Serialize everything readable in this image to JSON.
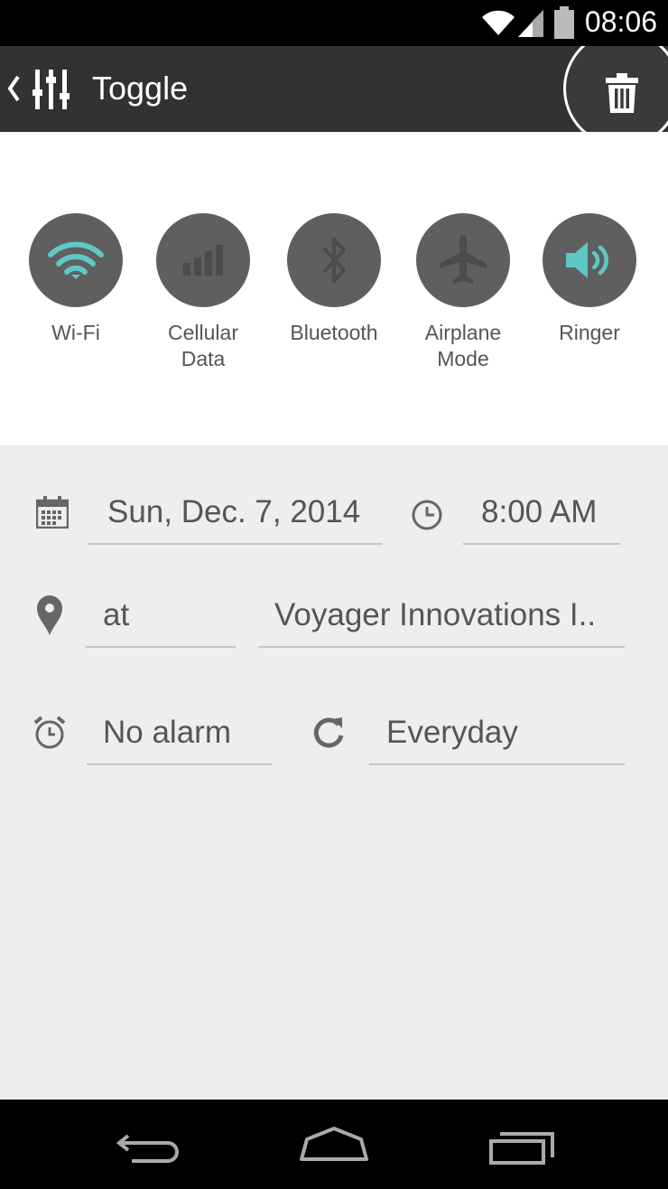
{
  "status_bar": {
    "time": "08:06",
    "icons": [
      "wifi-icon",
      "signal-icon",
      "battery-icon"
    ]
  },
  "action_bar": {
    "title": "Toggle",
    "icons": [
      "back-arrow-icon",
      "equalizer-icon",
      "trash-icon"
    ]
  },
  "toggles": [
    {
      "label": "Wi-Fi",
      "icon": "wifi-icon",
      "active": true
    },
    {
      "label": "Cellular\nData",
      "icon": "signal-icon",
      "active": false
    },
    {
      "label": "Bluetooth",
      "icon": "bluetooth-icon",
      "active": false
    },
    {
      "label": "Airplane\nMode",
      "icon": "airplane-icon",
      "active": false
    },
    {
      "label": "Ringer",
      "icon": "speaker-icon",
      "active": true
    }
  ],
  "schedule": {
    "date": "Sun, Dec. 7, 2014",
    "time": "8:00 AM",
    "location_prefix": "at",
    "location": "Voyager Innovations I..",
    "alarm": "No alarm",
    "repeat": "Everyday"
  },
  "colors": {
    "accent": "#5ec8c4",
    "toggle_bg": "#5f5f5f",
    "action_bar": "#323232",
    "form_bg": "#eeeeee"
  },
  "nav_bar": {
    "buttons": [
      "back-icon",
      "home-icon",
      "recents-icon"
    ]
  }
}
